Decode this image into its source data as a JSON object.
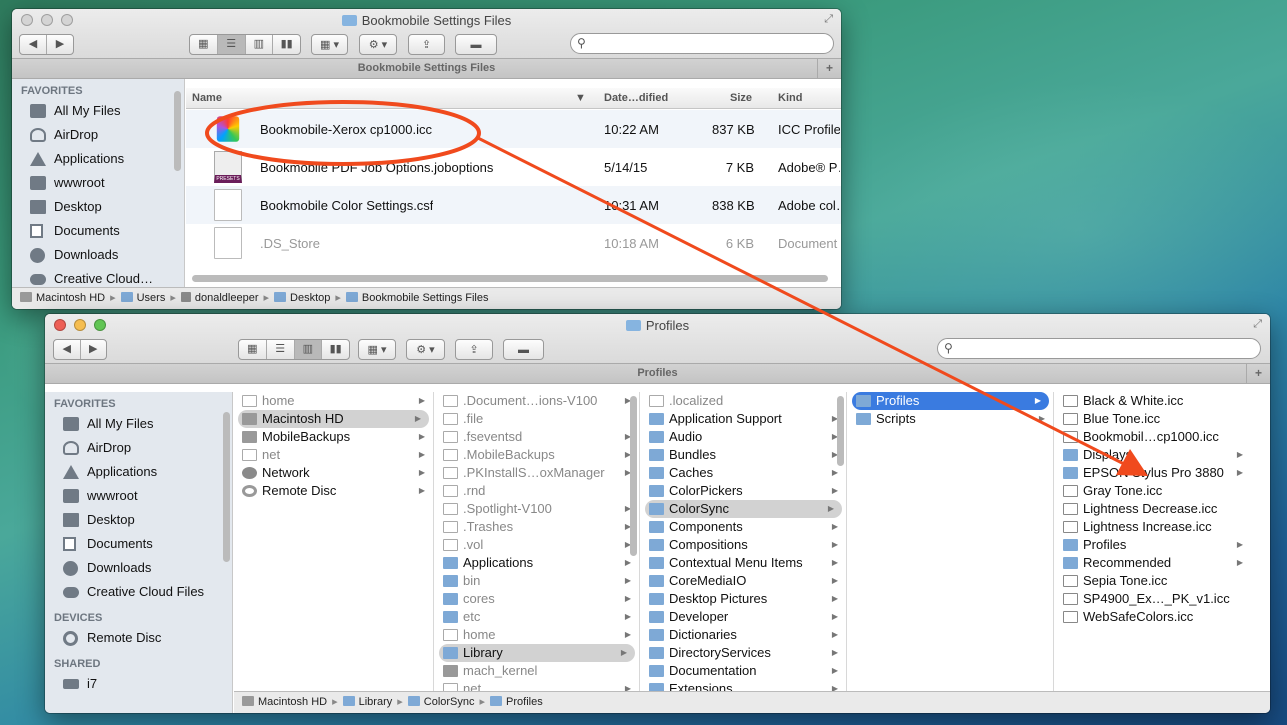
{
  "colors": {
    "annotation": "#f04a1d",
    "selection": "#3a7be0"
  },
  "top_window": {
    "title": "Bookmobile Settings Files",
    "tab_title": "Bookmobile Settings Files",
    "sidebar": {
      "favorites_header": "FAVORITES",
      "items": [
        {
          "label": "All My Files",
          "icon": "all-files-icon"
        },
        {
          "label": "AirDrop",
          "icon": "airdrop-icon"
        },
        {
          "label": "Applications",
          "icon": "applications-icon"
        },
        {
          "label": "wwwroot",
          "icon": "folder-icon"
        },
        {
          "label": "Desktop",
          "icon": "desktop-icon"
        },
        {
          "label": "Documents",
          "icon": "documents-icon"
        },
        {
          "label": "Downloads",
          "icon": "downloads-icon"
        },
        {
          "label": "Creative Cloud…",
          "icon": "cloud-icon"
        }
      ]
    },
    "columns": {
      "name": "Name",
      "date": "Date…dified",
      "size": "Size",
      "kind": "Kind"
    },
    "files": [
      {
        "name": "Bookmobile-Xerox cp1000.icc",
        "date": "10:22 AM",
        "size": "837 KB",
        "kind": "ICC Profile"
      },
      {
        "name": "Bookmobile PDF Job Options.joboptions",
        "date": "5/14/15",
        "size": "7 KB",
        "kind": "Adobe® P…"
      },
      {
        "name": "Bookmobile Color Settings.csf",
        "date": "10:31 AM",
        "size": "838 KB",
        "kind": "Adobe col…"
      },
      {
        "name": ".DS_Store",
        "date": "10:18 AM",
        "size": "6 KB",
        "kind": "Document"
      }
    ],
    "preset_label": "PRESETS",
    "path": [
      "Macintosh HD",
      "Users",
      "donaldleeper",
      "Desktop",
      "Bookmobile Settings Files"
    ]
  },
  "bottom_window": {
    "title": "Profiles",
    "tab_title": "Profiles",
    "sidebar": {
      "favorites_header": "FAVORITES",
      "favorites": [
        "All My Files",
        "AirDrop",
        "Applications",
        "wwwroot",
        "Desktop",
        "Documents",
        "Downloads",
        "Creative Cloud Files"
      ],
      "devices_header": "DEVICES",
      "devices": [
        "Remote Disc"
      ],
      "shared_header": "SHARED",
      "shared": [
        "i7"
      ]
    },
    "col1": [
      {
        "label": "home",
        "icon": "file",
        "arrow": true,
        "dim": true
      },
      {
        "label": "Macintosh HD",
        "icon": "hdd",
        "arrow": true,
        "sel": "gray"
      },
      {
        "label": "MobileBackups",
        "icon": "hdd",
        "arrow": true
      },
      {
        "label": "net",
        "icon": "file",
        "arrow": true,
        "dim": true
      },
      {
        "label": "Network",
        "icon": "net",
        "arrow": true
      },
      {
        "label": "Remote Disc",
        "icon": "disc",
        "arrow": true
      }
    ],
    "col2": [
      {
        "label": ".Document…ions-V100",
        "icon": "file",
        "arrow": true,
        "dim": true
      },
      {
        "label": ".file",
        "icon": "file",
        "dim": true
      },
      {
        "label": ".fseventsd",
        "icon": "file",
        "arrow": true,
        "dim": true
      },
      {
        "label": ".MobileBackups",
        "icon": "file",
        "arrow": true,
        "dim": true
      },
      {
        "label": ".PKInstallS…oxManager",
        "icon": "file",
        "arrow": true,
        "dim": true
      },
      {
        "label": ".rnd",
        "icon": "file",
        "dim": true
      },
      {
        "label": ".Spotlight-V100",
        "icon": "file",
        "arrow": true,
        "dim": true
      },
      {
        "label": ".Trashes",
        "icon": "file",
        "arrow": true,
        "dim": true
      },
      {
        "label": ".vol",
        "icon": "file",
        "arrow": true,
        "dim": true
      },
      {
        "label": "Applications",
        "icon": "folder",
        "arrow": true
      },
      {
        "label": "bin",
        "icon": "folder",
        "arrow": true,
        "dim": true
      },
      {
        "label": "cores",
        "icon": "folder",
        "arrow": true,
        "dim": true
      },
      {
        "label": "etc",
        "icon": "folder",
        "arrow": true,
        "dim": true
      },
      {
        "label": "home",
        "icon": "file",
        "arrow": true,
        "dim": true
      },
      {
        "label": "Library",
        "icon": "folder",
        "arrow": true,
        "sel": "gray"
      },
      {
        "label": "mach_kernel",
        "icon": "hdd",
        "dim": true
      },
      {
        "label": "net",
        "icon": "file",
        "arrow": true,
        "dim": true
      }
    ],
    "col3": [
      {
        "label": ".localized",
        "icon": "file",
        "dim": true
      },
      {
        "label": "Application Support",
        "icon": "folder",
        "arrow": true
      },
      {
        "label": "Audio",
        "icon": "folder",
        "arrow": true
      },
      {
        "label": "Bundles",
        "icon": "folder",
        "arrow": true
      },
      {
        "label": "Caches",
        "icon": "folder",
        "arrow": true
      },
      {
        "label": "ColorPickers",
        "icon": "folder",
        "arrow": true
      },
      {
        "label": "ColorSync",
        "icon": "folder",
        "arrow": true,
        "sel": "gray"
      },
      {
        "label": "Components",
        "icon": "folder",
        "arrow": true
      },
      {
        "label": "Compositions",
        "icon": "folder",
        "arrow": true
      },
      {
        "label": "Contextual Menu Items",
        "icon": "folder",
        "arrow": true
      },
      {
        "label": "CoreMediaIO",
        "icon": "folder",
        "arrow": true
      },
      {
        "label": "Desktop Pictures",
        "icon": "folder",
        "arrow": true
      },
      {
        "label": "Developer",
        "icon": "folder",
        "arrow": true
      },
      {
        "label": "Dictionaries",
        "icon": "folder",
        "arrow": true
      },
      {
        "label": "DirectoryServices",
        "icon": "folder",
        "arrow": true
      },
      {
        "label": "Documentation",
        "icon": "folder",
        "arrow": true
      },
      {
        "label": "Extensions",
        "icon": "folder",
        "arrow": true
      }
    ],
    "col4": [
      {
        "label": "Profiles",
        "icon": "folder",
        "arrow": true,
        "sel": "blue"
      },
      {
        "label": "Scripts",
        "icon": "alias",
        "arrow": true
      }
    ],
    "col5": [
      {
        "label": "Black & White.icc",
        "icon": "iccf"
      },
      {
        "label": "Blue Tone.icc",
        "icon": "iccf"
      },
      {
        "label": "Bookmobil…cp1000.icc",
        "icon": "iccf"
      },
      {
        "label": "Displays",
        "icon": "folder",
        "arrow": true
      },
      {
        "label": "EPSON Stylus Pro 3880",
        "icon": "folder",
        "arrow": true
      },
      {
        "label": "Gray Tone.icc",
        "icon": "iccf"
      },
      {
        "label": "Lightness Decrease.icc",
        "icon": "iccf"
      },
      {
        "label": "Lightness Increase.icc",
        "icon": "iccf"
      },
      {
        "label": "Profiles",
        "icon": "alias",
        "arrow": true
      },
      {
        "label": "Recommended",
        "icon": "alias",
        "arrow": true
      },
      {
        "label": "Sepia Tone.icc",
        "icon": "iccf"
      },
      {
        "label": "SP4900_Ex…_PK_v1.icc",
        "icon": "iccf"
      },
      {
        "label": "WebSafeColors.icc",
        "icon": "iccf"
      }
    ],
    "path": [
      "Macintosh HD",
      "Library",
      "ColorSync",
      "Profiles"
    ]
  }
}
